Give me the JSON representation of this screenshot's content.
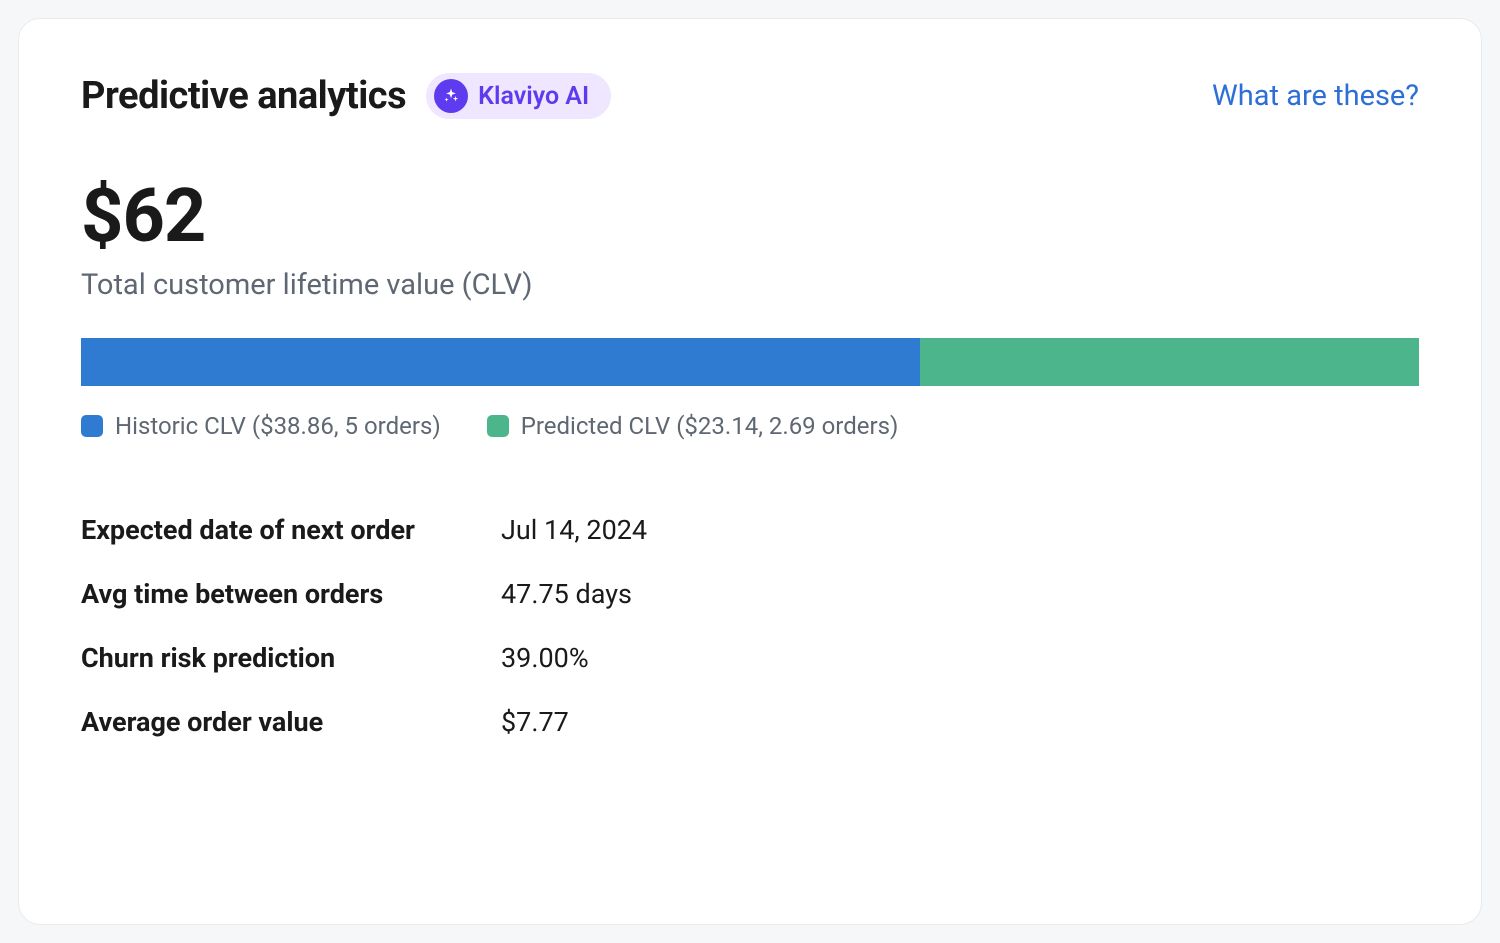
{
  "header": {
    "title": "Predictive analytics",
    "ai_badge_label": "Klaviyo AI",
    "help_link_label": "What are these?"
  },
  "clv": {
    "total_value": "$62",
    "subtitle": "Total customer lifetime value (CLV)"
  },
  "chart_data": {
    "type": "bar",
    "title": "Total customer lifetime value (CLV)",
    "series": [
      {
        "name": "Historic CLV",
        "amount_usd": 38.86,
        "orders": 5,
        "color": "#2f7bd1"
      },
      {
        "name": "Predicted CLV",
        "amount_usd": 23.14,
        "orders": 2.69,
        "color": "#4db58c"
      }
    ],
    "total_usd": 62.0,
    "legend_labels": {
      "historic": "Historic CLV ($38.86, 5 orders)",
      "predicted": "Predicted CLV ($23.14, 2.69 orders)"
    }
  },
  "stats": {
    "rows": [
      {
        "label": "Expected date of next order",
        "value": "Jul 14, 2024"
      },
      {
        "label": "Avg time between orders",
        "value": "47.75 days"
      },
      {
        "label": "Churn risk prediction",
        "value": "39.00%"
      },
      {
        "label": "Average order value",
        "value": "$7.77"
      }
    ]
  }
}
